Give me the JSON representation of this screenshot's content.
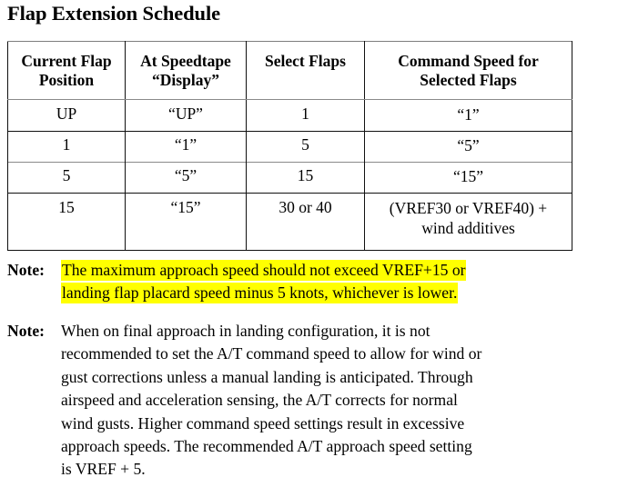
{
  "document": {
    "title": "Flap Extension Schedule"
  },
  "table": {
    "headers": [
      {
        "line1": "Current Flap",
        "line2": "Position"
      },
      {
        "line1": "At Speedtape",
        "line2": "“Display”"
      },
      {
        "line1": "Select Flaps",
        "line2": ""
      },
      {
        "line1": "Command Speed for",
        "line2": "Selected Flaps"
      }
    ],
    "rows": [
      {
        "current_flap_position": "UP",
        "at_speedtape_display": "“UP”",
        "select_flaps": "1",
        "command_speed_line1": "“1”",
        "command_speed_line2": ""
      },
      {
        "current_flap_position": "1",
        "at_speedtape_display": "“1”",
        "select_flaps": "5",
        "command_speed_line1": "“5”",
        "command_speed_line2": ""
      },
      {
        "current_flap_position": "5",
        "at_speedtape_display": "“5”",
        "select_flaps": "15",
        "command_speed_line1": "“15”",
        "command_speed_line2": ""
      },
      {
        "current_flap_position": "15",
        "at_speedtape_display": "“15”",
        "select_flaps": "30 or 40",
        "command_speed_line1": "(VREF30 or VREF40) +",
        "command_speed_line2": "wind additives"
      }
    ]
  },
  "notes": [
    {
      "label": "Note:",
      "highlighted": true,
      "highlight_color": "#ffff00",
      "lines": [
        "The maximum approach speed should not exceed VREF+15 or",
        "landing flap placard speed minus 5 knots, whichever is lower."
      ]
    },
    {
      "label": "Note:",
      "highlighted": false,
      "lines": [
        "When on final approach in landing configuration, it is not",
        "recommended to set the A/T command speed to allow for wind or",
        "gust corrections unless a manual landing is anticipated. Through",
        "airspeed and acceleration sensing, the A/T corrects for normal",
        "wind gusts. Higher command speed settings result in excessive",
        "approach speeds. The recommended A/T approach speed setting",
        "is VREF + 5."
      ]
    }
  ]
}
